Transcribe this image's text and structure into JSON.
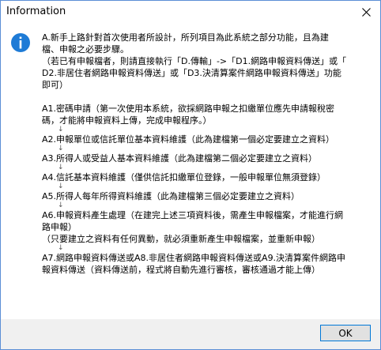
{
  "window": {
    "title": "Information"
  },
  "icons": {
    "info": "info-icon",
    "close": "close-icon",
    "arrow": "down-arrow-icon"
  },
  "message": {
    "intro_1": "A.新手上路針對首次使用者所設計，所列項目為此系統之部分功能，且為建",
    "intro_2": "檔、申報之必要步驟。",
    "intro_3": "（若已有申報檔者，則請直接執行「D.傳輸」->「D1.網路申報資料傳送」或「",
    "intro_4": "D2.非居住者網路申報資料傳送」或「D3.決清算案件網路申報資料傳送」功能",
    "intro_5": "即可）",
    "step_a1_1": "A1.密碼申請（第一次使用本系統，欲採網路申報之扣繳單位應先申請報稅密",
    "step_a1_2": "碼，才能將申報資料上傳，完成申報程序。）",
    "step_a2": "A2.申報單位或信託單位基本資料維護（此為建檔第一個必定要建立之資料）",
    "step_a3": "A3.所得人或受益人基本資料維護（此為建檔第二個必定要建立之資料）",
    "step_a4": "A4.信託基本資料維護（僅供信託扣繳單位登錄，一般申報單位無須登錄）",
    "step_a5": "A5.所得人每年所得資料維護（此為建檔第三個必定要建立之資料）",
    "step_a6_1": "A6.申報資料產生處理（在建完上述三項資料後，需產生申報檔案，才能進行網",
    "step_a6_2": "路申報）",
    "step_a6_3": "（只要建立之資料有任何異動，就必須重新產生申報檔案，並重新申報）",
    "step_a7_1": "A7.網路申報資料傳送或A8.非居住者網路申報資料傳送或A9.決清算案件網路申",
    "step_a7_2": "報資料傳送（資料傳送前，程式將自動先進行審核，審核通過才能上傳）",
    "arrow_glyph": "↓"
  },
  "buttons": {
    "ok": "OK"
  },
  "colors": {
    "info_icon": "#1e7bd6",
    "border": "#5b8fd6",
    "ok_border": "#0078d7"
  }
}
